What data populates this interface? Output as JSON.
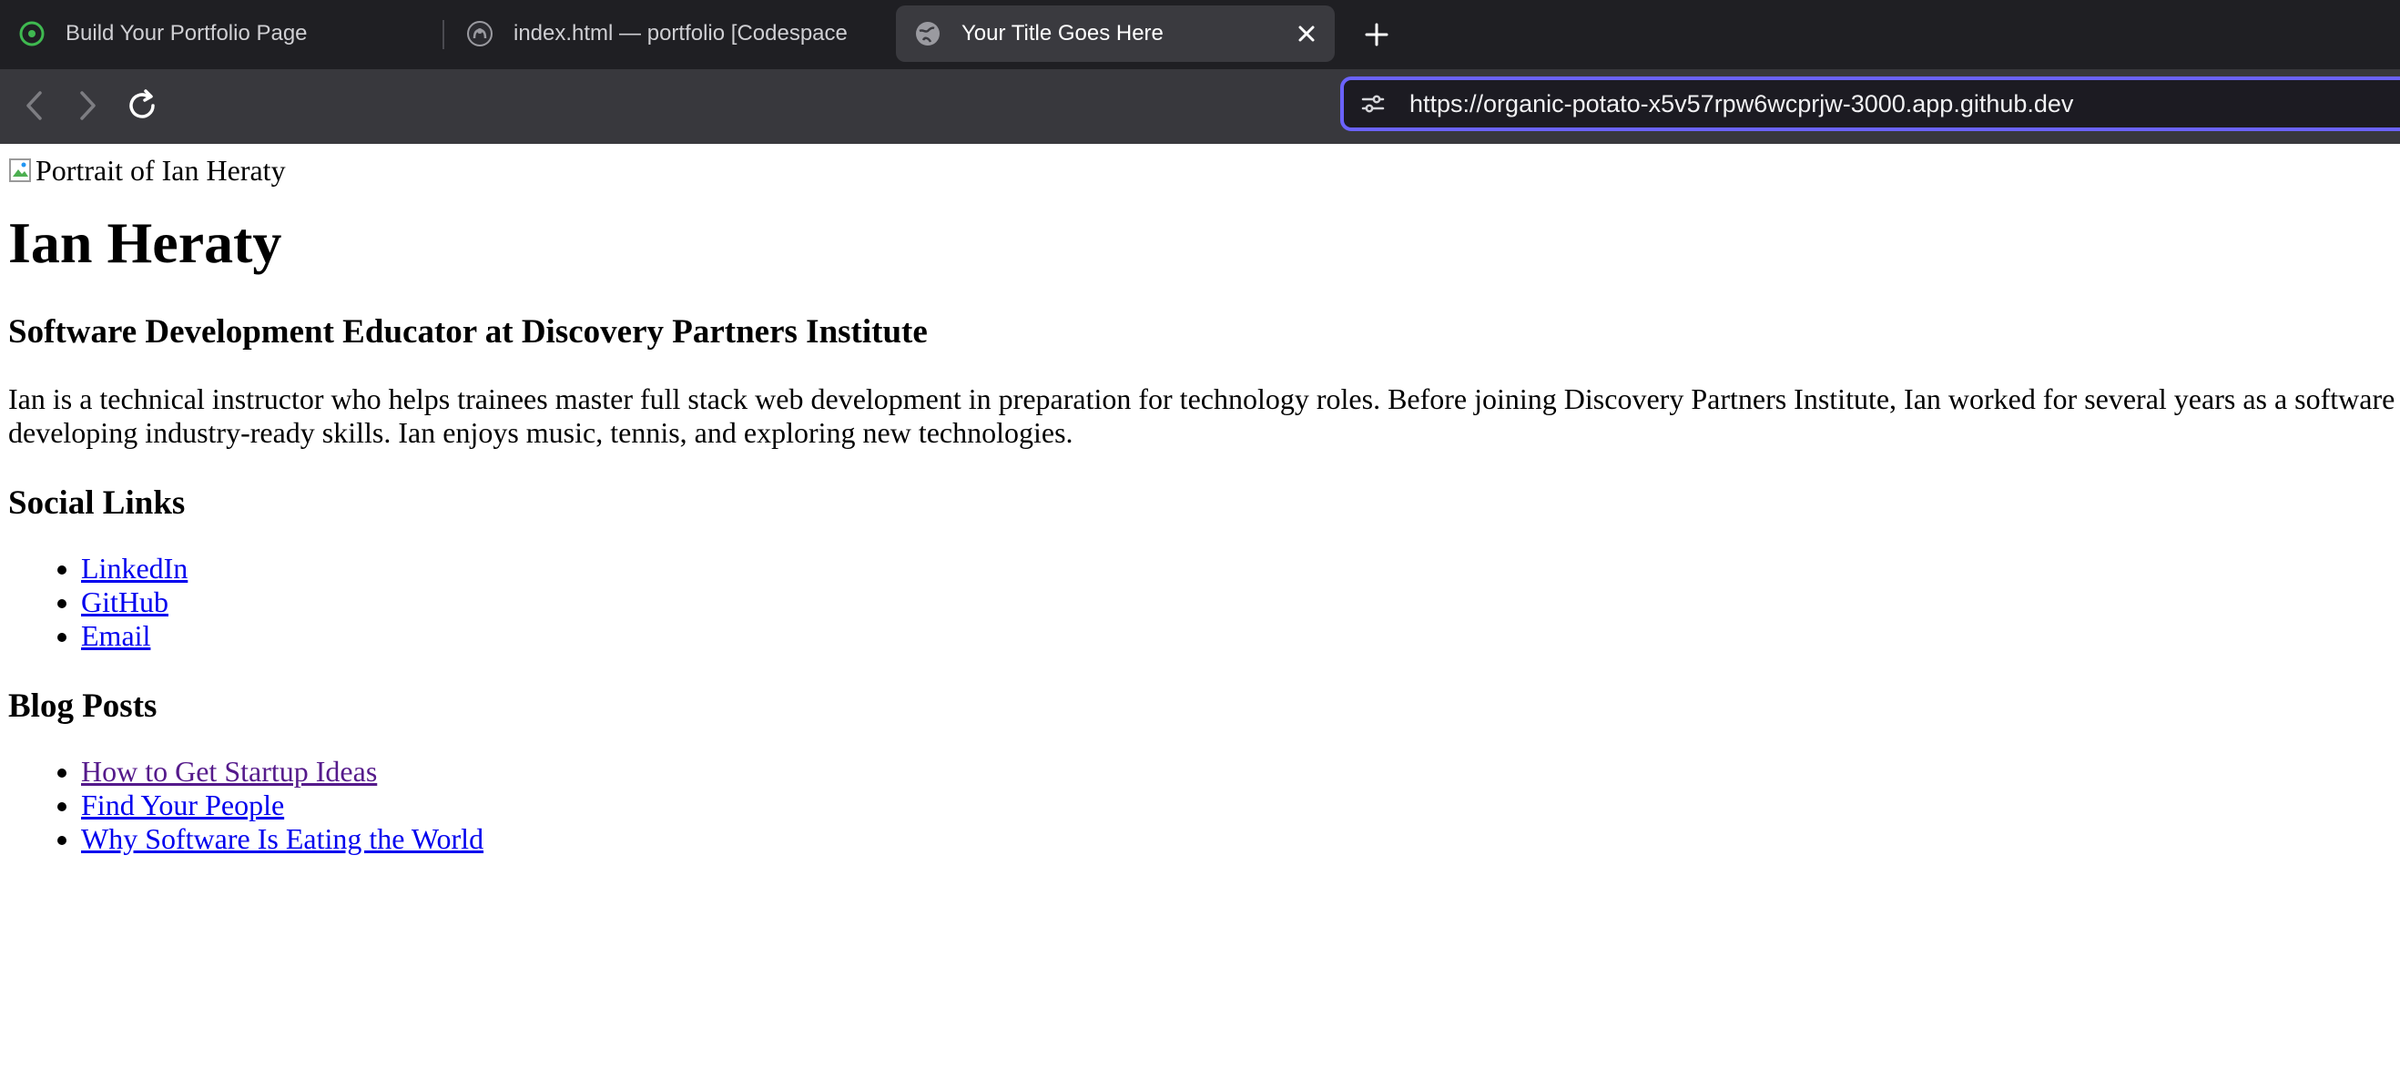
{
  "browser": {
    "tabs": [
      {
        "label": "Build Your Portfolio Page",
        "icon": "codespaces-circle-icon",
        "active": false
      },
      {
        "label": "index.html — portfolio [Codespace",
        "icon": "github-icon",
        "active": false
      },
      {
        "label": "Your Title Goes Here",
        "icon": "globe-icon",
        "active": true
      }
    ],
    "url": "https://organic-potato-x5v57rpw6wcprjw-3000.app.github.dev"
  },
  "page": {
    "portrait_alt": "Portrait of Ian Heraty",
    "name": "Ian Heraty",
    "role": "Software Development Educator at Discovery Partners Institute",
    "bio_line1": "Ian is a technical instructor who helps trainees master full stack web development in preparation for technology roles. Before joining Discovery Partners Institute, Ian worked for several years as a software",
    "bio_line2": "developing industry-ready skills. Ian enjoys music, tennis, and exploring new technologies.",
    "social_heading": "Social Links",
    "social_links": [
      "LinkedIn",
      "GitHub",
      "Email"
    ],
    "blog_heading": "Blog Posts",
    "blog_posts": [
      "How to Get Startup Ideas",
      "Find Your People",
      "Why Software Is Eating the World"
    ]
  },
  "colors": {
    "tab_bar": "#1f1f23",
    "toolbar": "#38383d",
    "url_focus_ring": "#6b63ff",
    "link": "#0000ee",
    "visited_link": "#551a8b"
  }
}
